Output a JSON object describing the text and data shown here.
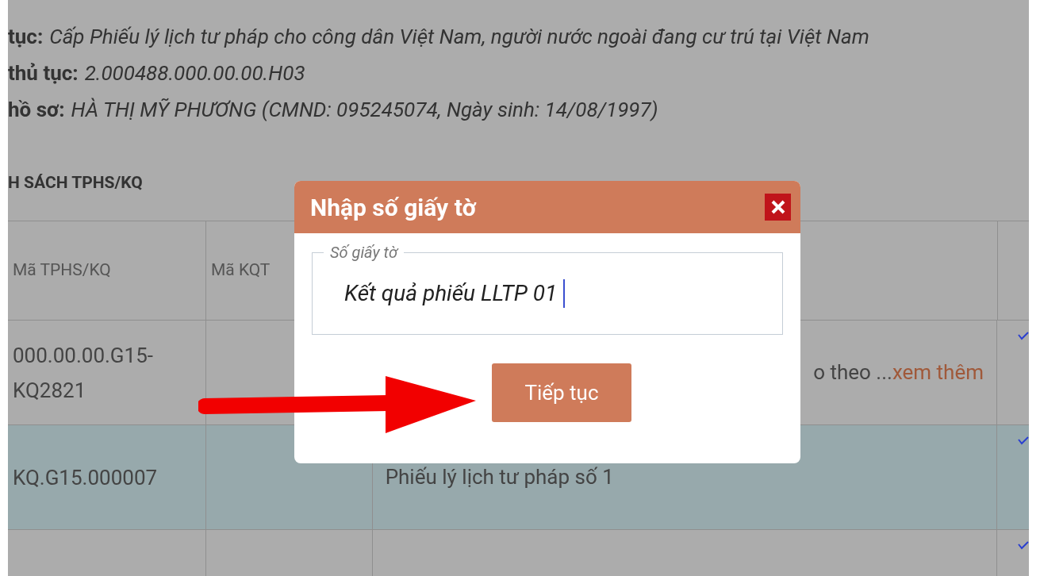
{
  "info": [
    {
      "label": "tục:",
      "value": "Cấp Phiếu lý lịch tư pháp cho công dân Việt Nam, người nước ngoài đang cư trú tại Việt Nam"
    },
    {
      "label": "thủ tục:",
      "value": "2.000488.000.00.00.H03"
    },
    {
      "label": "hồ sơ:",
      "value": "HÀ THỊ MỸ PHƯƠNG (CMND:  095245074, Ngày sinh:  14/08/1997)"
    }
  ],
  "list_heading": "H SÁCH TPHS/KQ",
  "table": {
    "columns": [
      "Mã TPHS/KQ",
      "Mã KQT"
    ],
    "rows": [
      {
        "code": "000.00.00.G15-KQ2821",
        "name": "o theo ...",
        "link": "xem thêm",
        "selected": false
      },
      {
        "code": "KQ.G15.000007",
        "name": "Phiếu lý lịch tư pháp số 1",
        "selected": true
      },
      {
        "selected": false
      }
    ]
  },
  "dialog": {
    "title": "Nhập số giấy tờ",
    "field": {
      "label": "Số giấy tờ",
      "value": "Kết quả phiếu LLTP 01"
    },
    "button": "Tiếp tục"
  }
}
